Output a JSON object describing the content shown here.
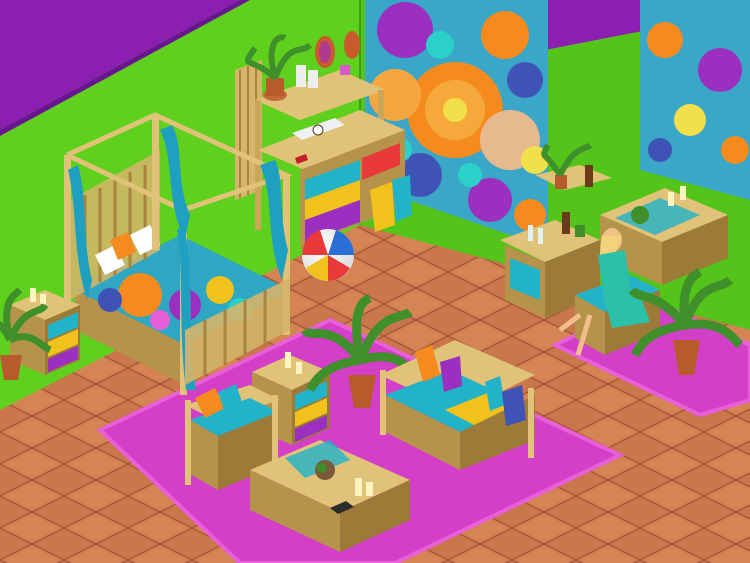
{
  "scene": {
    "colors": {
      "wall_green": "#5fd01e",
      "wall_green_shadow": "#46b512",
      "wall_top_purple": "#8a1fb0",
      "floor_tile": "#c9764a",
      "floor_tile_alt": "#d98858",
      "floor_grout": "#a9593a",
      "rug_magenta": "#d43fc8",
      "rug_border": "#e85fd9",
      "bamboo": "#e0c278",
      "bamboo_dark": "#b5934a",
      "turquoise": "#22b3c8",
      "yellow": "#f2c21c",
      "purple": "#9a2fc0",
      "mural_orange": "#f58a1f",
      "mural_blue": "#3f52b5",
      "leaf_green": "#3f8f2a"
    },
    "objects": [
      "four-poster-bamboo-bed",
      "nightstand-left",
      "nightstand-center",
      "dresser-with-shelf",
      "floral-mural",
      "beach-ball",
      "bamboo-sofa",
      "bamboo-armchair",
      "coffee-table",
      "dining-table",
      "bar-cabinet",
      "potted-palm-left",
      "potted-palm-center",
      "potted-palm-right",
      "seated-sim"
    ]
  }
}
